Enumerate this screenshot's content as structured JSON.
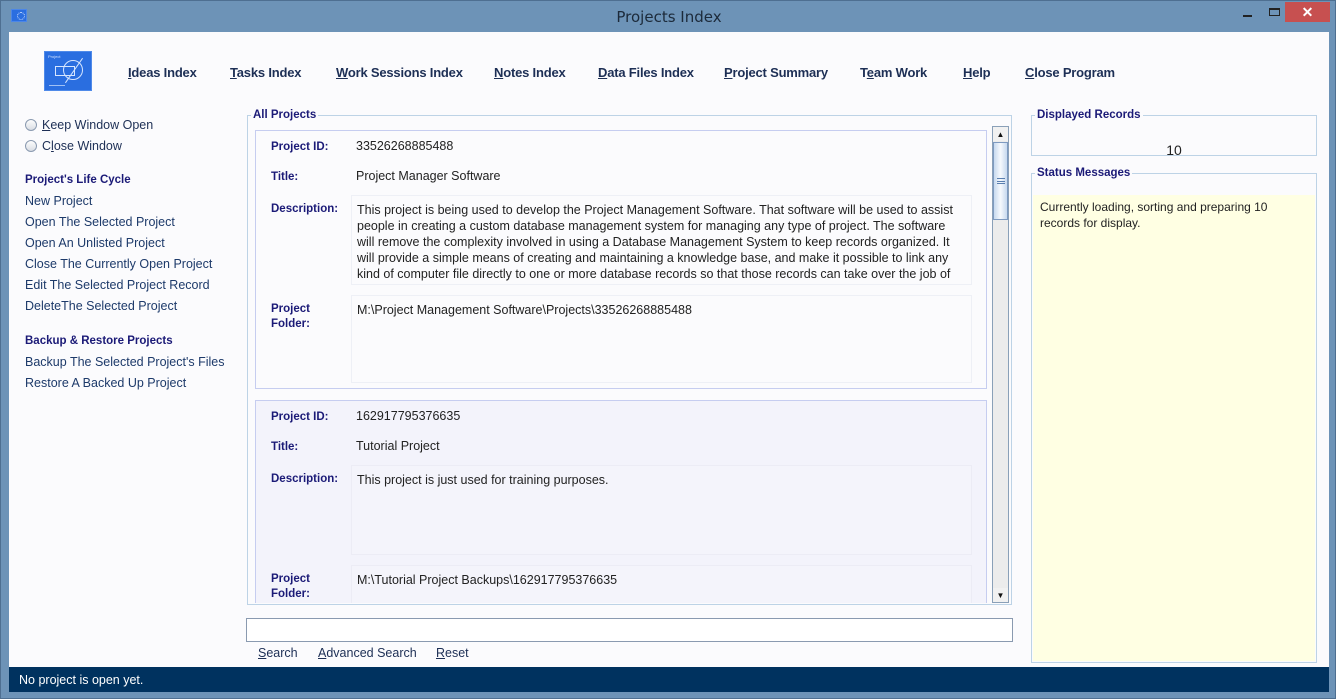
{
  "window": {
    "title": "Projects Index",
    "controls": {
      "minimize": "minimize",
      "maximize": "maximize",
      "close": "✕"
    }
  },
  "topnav": [
    {
      "pre": "",
      "u": "I",
      "post": "deas Index"
    },
    {
      "pre": "",
      "u": "T",
      "post": "asks Index"
    },
    {
      "pre": "",
      "u": "W",
      "post": "ork Sessions Index"
    },
    {
      "pre": "",
      "u": "N",
      "post": "otes Index"
    },
    {
      "pre": "",
      "u": "D",
      "post": "ata Files Index"
    },
    {
      "pre": "",
      "u": "P",
      "post": "roject Summary"
    },
    {
      "pre": "T",
      "u": "e",
      "post": "am Work"
    },
    {
      "pre": "",
      "u": "H",
      "post": "elp"
    },
    {
      "pre": "",
      "u": "C",
      "post": "lose Program"
    }
  ],
  "sidebar": {
    "radios": [
      {
        "pre": "",
        "u": "K",
        "post": "eep Window Open",
        "checked": false
      },
      {
        "pre": "C",
        "u": "l",
        "post": "ose Window",
        "checked": false
      }
    ],
    "lifecycle": {
      "heading": "Project's Life Cycle",
      "items": [
        "New Project",
        "Open The Selected Project",
        "Open An Unlisted Project",
        "Close The Currently Open Project",
        "Edit The Selected Project Record",
        "DeleteThe Selected Project"
      ]
    },
    "backup": {
      "heading": "Backup & Restore Projects",
      "items": [
        "Backup The Selected Project's Files",
        "Restore A Backed Up Project"
      ]
    }
  },
  "projects": {
    "legend": "All Projects",
    "labels": {
      "id": "Project ID:",
      "title": "Title:",
      "description": "Description:",
      "folder_line1": "Project",
      "folder_line2": "Folder:"
    },
    "records": [
      {
        "id": "33526268885488",
        "title": "Project Manager Software",
        "description": "This project is being used to develop the Project Management Software. That software will be used to assist people in creating a custom database management system for managing any type of project. The software will remove the complexity involved in using a Database Management System to keep records organized. It will provide a simple means of creating and maintaining a knowledge base, and make it possible to link any kind of computer file directly to one or more database records so that those records can take over the job of",
        "folder": "M:\\Project Management Software\\Projects\\33526268885488"
      },
      {
        "id": "162917795376635",
        "title": "Tutorial Project",
        "description": "This project is just used for training purposes.",
        "folder": "M:\\Tutorial Project Backups\\162917795376635"
      }
    ]
  },
  "search": {
    "value": "",
    "placeholder": "",
    "buttons": [
      {
        "pre": "",
        "u": "S",
        "post": "earch"
      },
      {
        "pre": "",
        "u": "A",
        "post": "dvanced Search"
      },
      {
        "pre": "",
        "u": "R",
        "post": "eset"
      }
    ]
  },
  "displayed_records": {
    "legend": "Displayed Records",
    "value": "10"
  },
  "status_messages": {
    "legend": "Status Messages",
    "text": "Currently loading, sorting and preparing 10 records for display."
  },
  "statusbar": {
    "text": "No project is open yet."
  },
  "colors": {
    "titlebar": "#6d93b7",
    "close_button": "#c75050",
    "statusbar": "#00325f",
    "heading": "#1b1a77",
    "status_bg": "#ffffe3"
  }
}
